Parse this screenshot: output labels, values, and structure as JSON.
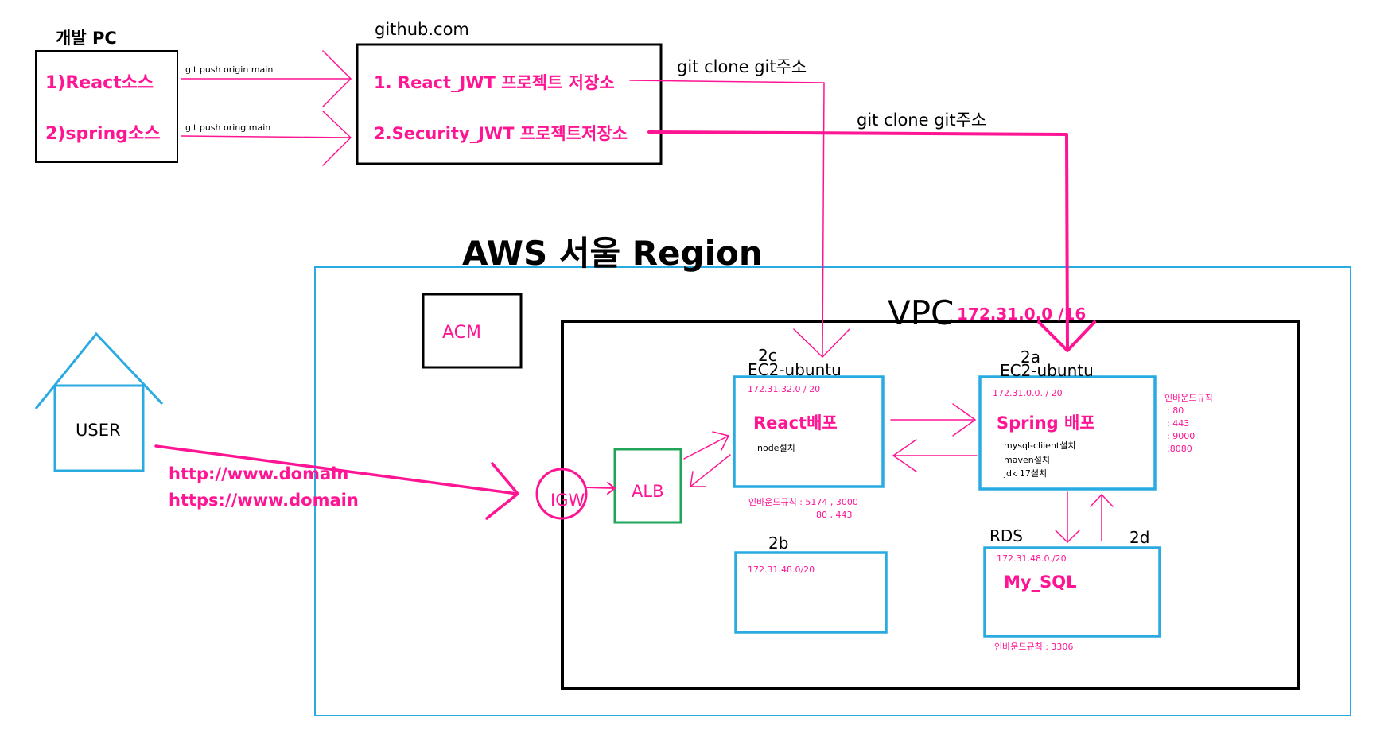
{
  "dev_pc": {
    "title": "개발 PC",
    "item1": "1)React소스",
    "item2": "2)spring소스",
    "push1": "git push origin main",
    "push2": "git push oring main"
  },
  "github": {
    "title": "github.com",
    "repo1": "1. React_JWT 프로젝트 저장소",
    "repo2": "2.Security_JWT 프로젝트저장소",
    "clone1": "git clone git주소",
    "clone2": "git clone git주소"
  },
  "aws": {
    "region_title": "AWS 서울 Region",
    "acm": "ACM"
  },
  "vpc": {
    "title": "VPC",
    "cidr": "172.31.0.0 /16"
  },
  "user": {
    "label": "USER",
    "url_http": "http://www.domain",
    "url_https": "https://www.domain"
  },
  "igw": "IGW",
  "alb": "ALB",
  "ec2_react": {
    "az": "2c",
    "name": "EC2-ubuntu",
    "subnet": "172.31.32.0 / 20",
    "title": "React배포",
    "detail": "node설치",
    "inbound_line1": "인바운드규칙 : 5174 , 3000",
    "inbound_line2": "80 , 443"
  },
  "ec2_spring": {
    "az": "2a",
    "name": "EC2-ubuntu",
    "subnet": "172.31.0.0. / 20",
    "title": "Spring 배포",
    "details": [
      "mysql-cliient설치",
      "maven설치",
      "jdk 17설치"
    ],
    "inbound_title": "인바운드규칙",
    "inbound_ports": [
      ": 80",
      ": 443",
      ": 9000",
      ":8080"
    ]
  },
  "subnet_2b": {
    "az": "2b",
    "subnet": "172.31.48.0/20"
  },
  "rds": {
    "label": "RDS",
    "az": "2d",
    "subnet": "172.31.48.0./20",
    "title": "My_SQL",
    "inbound": "인바운드규칙 : 3306"
  },
  "colors": {
    "accent": "#ff1493",
    "aws_border": "#29abe2",
    "alb_border": "#22a559",
    "box_border": "#000000"
  }
}
